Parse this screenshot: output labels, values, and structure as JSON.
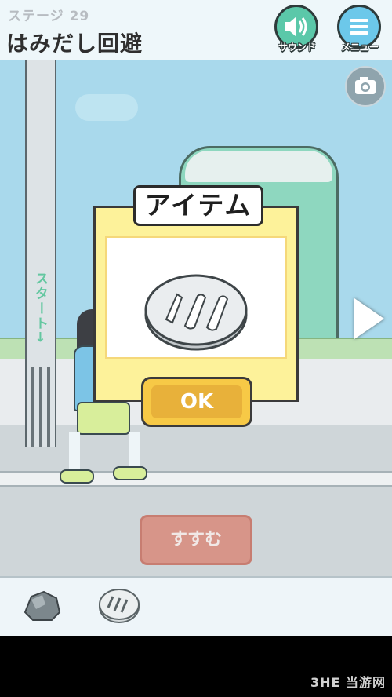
{
  "header": {
    "stage_label": "ステージ 29",
    "stage_title": "はみだし回避"
  },
  "buttons": {
    "sound_label": "サウンド",
    "menu_label": "メニュー"
  },
  "scene": {
    "start_sign": "スタート→"
  },
  "dialog": {
    "title": "アイテム",
    "ok_label": "OK",
    "item_icon": "100-yen-coin-icon"
  },
  "proceed_label": "すすむ",
  "inventory": [
    {
      "icon": "rock-icon"
    },
    {
      "icon": "100-yen-coin-icon"
    }
  ],
  "watermark": "3HE 当游网",
  "colors": {
    "accent_green": "#5bc8a9",
    "accent_blue": "#6cc8ea",
    "dialog_yellow": "#fdf29a",
    "ok_yellow": "#f7c946",
    "proceed_red": "#d98a7c"
  }
}
